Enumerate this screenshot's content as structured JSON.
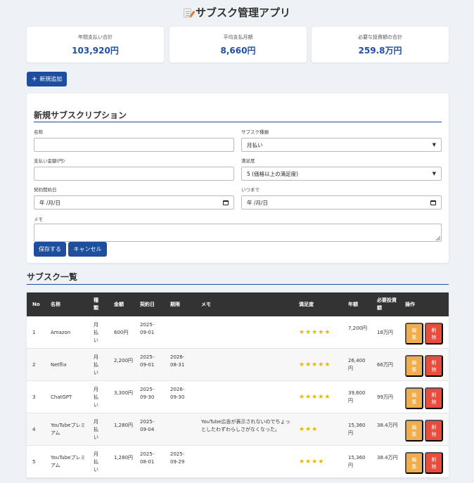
{
  "app": {
    "title": "サブスク管理アプリ"
  },
  "summary": [
    {
      "label": "年間支払い合計",
      "value": "103,920円"
    },
    {
      "label": "平均支払月額",
      "value": "8,660円"
    },
    {
      "label": "必要な投資額の合計",
      "value": "259.8万円"
    }
  ],
  "toolbar": {
    "add_label": "新規追加"
  },
  "form": {
    "title": "新規サブスクリプション",
    "name_label": "名称",
    "type_label": "サブスク種類",
    "type_value": "月払い",
    "amount_label": "支払い金額(円)",
    "satisfaction_label": "満足度",
    "satisfaction_value": "5 (価格以上の満足度)",
    "start_label": "契約開始日",
    "start_value": "年 /月/日",
    "until_label": "いつまで",
    "until_value": "年 /月/日",
    "memo_label": "メモ",
    "save_label": "保存する",
    "cancel_label": "キャンセル"
  },
  "list": {
    "title": "サブスク一覧",
    "headers": [
      "No",
      "名称",
      "種類",
      "金額",
      "契約日",
      "期限",
      "メモ",
      "満足度",
      "年額",
      "必要投資額",
      "操作"
    ],
    "edit_label": "編集",
    "delete_label": "削除",
    "rows": [
      {
        "no": "1",
        "name": "Amazon",
        "type": "月払い",
        "amount": "600円",
        "start": "2025-09-01",
        "end": "",
        "memo": "",
        "rating": 5,
        "annual": "7,200円",
        "invest": "18万円"
      },
      {
        "no": "2",
        "name": "Netflix",
        "type": "月払い",
        "amount": "2,200円",
        "start": "2025-09-01",
        "end": "2026-08-31",
        "memo": "",
        "rating": 5,
        "annual": "26,400円",
        "invest": "66万円"
      },
      {
        "no": "3",
        "name": "ChatGPT",
        "type": "月払い",
        "amount": "3,300円",
        "start": "2025-09-30",
        "end": "2026-09-30",
        "memo": "",
        "rating": 5,
        "annual": "39,600円",
        "invest": "99万円"
      },
      {
        "no": "4",
        "name": "YouTubeプレミアム",
        "type": "月払い",
        "amount": "1,280円",
        "start": "2025-09-04",
        "end": "",
        "memo": "YouTube広告が表示されないのでちょっとしたわずわらしさがなくなった。",
        "rating": 3,
        "annual": "15,360円",
        "invest": "38.4万円"
      },
      {
        "no": "5",
        "name": "YouTubeプレミアム",
        "type": "月払い",
        "amount": "1,280円",
        "start": "2025-08-01",
        "end": "2025-09-29",
        "memo": "",
        "rating": 4,
        "annual": "15,360円",
        "invest": "38.4万円"
      }
    ]
  },
  "colors": {
    "accent": "#1d4f9e",
    "edit": "#f0ad4e",
    "delete": "#e74c3c",
    "header": "#333333",
    "star": "#e8b600"
  }
}
